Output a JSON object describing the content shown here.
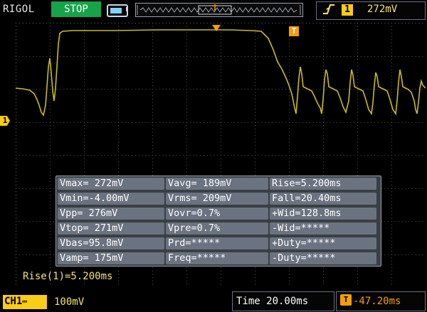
{
  "header": {
    "brand": "RIGOL",
    "run_state": "STOP",
    "trigger": {
      "edge_icon": "rising-edge-icon",
      "channel": "1",
      "level": "272mV"
    }
  },
  "markers": {
    "channel_marker": "1",
    "trigger_level_marker": "T"
  },
  "measurements": {
    "rows": [
      [
        "Vmax= 272mV",
        "Vavg= 189mV",
        "Rise=5.200ms"
      ],
      [
        "Vmin=-4.00mV",
        "Vrms= 209mV",
        "Fall=20.40ms"
      ],
      [
        "Vpp= 276mV",
        "Vovr=0.7%",
        "+Wid=128.8ms"
      ],
      [
        "Vtop= 271mV",
        "Vpre=0.7%",
        "-Wid=*****"
      ],
      [
        "Vbas=95.8mV",
        "Prd=*****",
        "+Duty=*****"
      ],
      [
        "Vamp= 175mV",
        "Freq=*****",
        "-Duty=*****"
      ]
    ],
    "selected": "Rise(1)=5.200ms"
  },
  "footer": {
    "channel_label": "CH1",
    "channel_scale": "100mV",
    "timebase": "Time 20.00ms",
    "trigger_offset_icon": "T",
    "trigger_offset": "-47.20ms"
  },
  "colors": {
    "trace": "#c8bd1e",
    "accent_yellow": "#facc15",
    "stop_green": "#16a34a",
    "trigger_orange": "#f59e0b"
  }
}
